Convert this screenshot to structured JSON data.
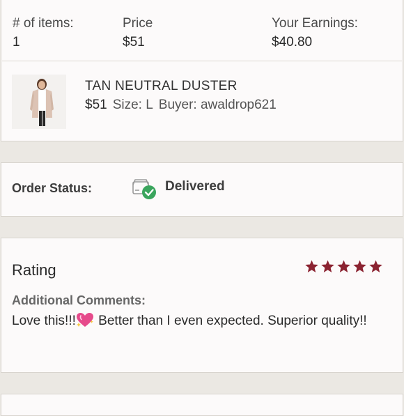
{
  "summary": {
    "items_label": "# of items:",
    "items_value": "1",
    "price_label": "Price",
    "price_value": "$51",
    "earnings_label": "Your Earnings:",
    "earnings_value": "$40.80"
  },
  "product": {
    "title": "TAN NEUTRAL DUSTER",
    "price": "$51",
    "size": "Size: L",
    "buyer": "Buyer: awaldrop621",
    "thumbnail_icon": "product-photo"
  },
  "order": {
    "status_label": "Order Status:",
    "status_value": "Delivered",
    "status_icon": "delivered-box-icon",
    "status_color": "#3aa55d"
  },
  "rating": {
    "title": "Rating",
    "stars": 5,
    "max_stars": 5,
    "star_color": "#8b2331",
    "comments_label": "Additional Comments:",
    "comment_part1": "Love this!!!",
    "comment_emoji": "sparkling-heart-icon",
    "comment_part2": " Better than I even expected. Superior quality!!"
  }
}
